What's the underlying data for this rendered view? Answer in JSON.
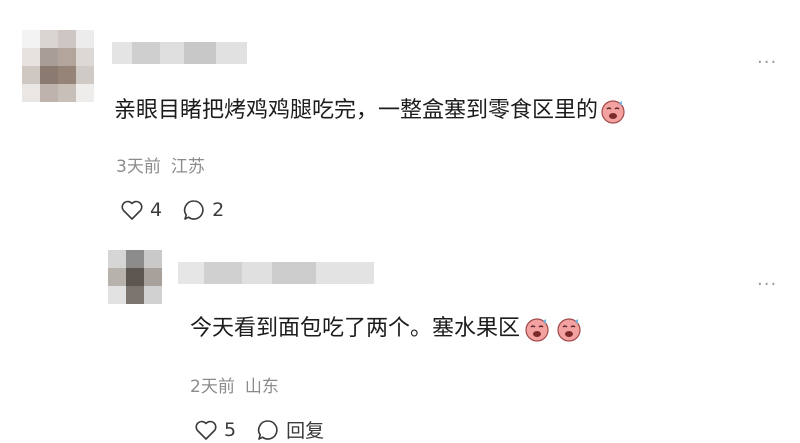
{
  "comments": [
    {
      "content": "亲眼目睹把烤鸡鸡腿吃完，一整盒塞到零食区里的",
      "time": "3天前",
      "location": "江苏",
      "likes": "4",
      "replies": "2",
      "more_label": "···",
      "emoji_icons": [
        "crying-face-emoji-icon"
      ]
    },
    {
      "content": "今天看到面包吃了两个。塞水果区",
      "time": "2天前",
      "location": "山东",
      "likes": "5",
      "reply_label": "回复",
      "more_label": "···",
      "emoji_icons": [
        "crying-face-emoji-icon",
        "crying-face-emoji-icon"
      ]
    }
  ],
  "colors": {
    "text": "#1c1c1c",
    "meta": "#8c8c8c",
    "icon": "#3a3a3a",
    "emoji_face": "#f4a1a1"
  }
}
